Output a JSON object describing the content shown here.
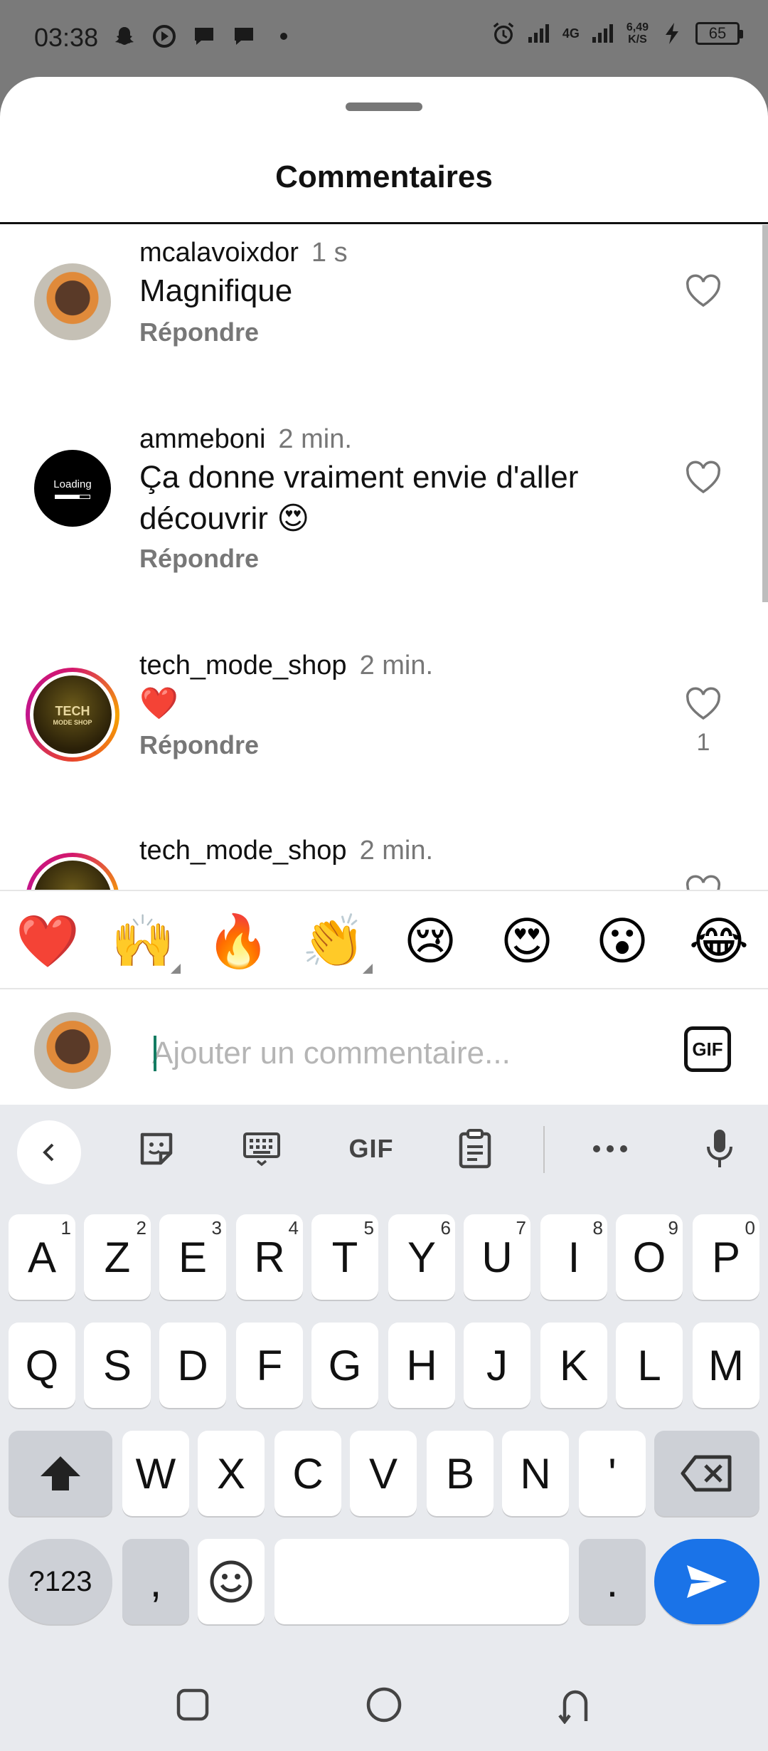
{
  "status_bar": {
    "time": "03:38",
    "network": "4G",
    "speed_value": "6,49",
    "speed_unit": "K/S",
    "battery": "65"
  },
  "sheet": {
    "title": "Commentaires"
  },
  "comments": [
    {
      "user": "mcalavoixdor",
      "time": "1 s",
      "text": "Magnifique",
      "reply": "Répondre",
      "likes": ""
    },
    {
      "user": "ammeboni",
      "time": "2 min.",
      "text": "Ça donne vraiment envie d'aller découvrir 😍",
      "reply": "Répondre",
      "likes": ""
    },
    {
      "user": "tech_mode_shop",
      "time": "2 min.",
      "text": "❤️",
      "reply": "Répondre",
      "likes": "1"
    },
    {
      "user": "tech_mode_shop",
      "time": "2 min.",
      "text": "",
      "reply": "",
      "likes": ""
    }
  ],
  "avatar_texts": {
    "loading": "Loading",
    "tech": "TECH",
    "tech_sub": "MODE SHOP"
  },
  "emoji_bar": [
    "❤️",
    "🙌",
    "🔥",
    "👏",
    "😢",
    "😍",
    "😮",
    "😂"
  ],
  "input": {
    "placeholder": "Ajouter un commentaire...",
    "gif_label": "GIF"
  },
  "keyboard": {
    "toolbar_gif": "GIF",
    "row1": [
      {
        "k": "A",
        "h": "1"
      },
      {
        "k": "Z",
        "h": "2"
      },
      {
        "k": "E",
        "h": "3"
      },
      {
        "k": "R",
        "h": "4"
      },
      {
        "k": "T",
        "h": "5"
      },
      {
        "k": "Y",
        "h": "6"
      },
      {
        "k": "U",
        "h": "7"
      },
      {
        "k": "I",
        "h": "8"
      },
      {
        "k": "O",
        "h": "9"
      },
      {
        "k": "P",
        "h": "0"
      }
    ],
    "row2": [
      "Q",
      "S",
      "D",
      "F",
      "G",
      "H",
      "J",
      "K",
      "L",
      "M"
    ],
    "row3": [
      "W",
      "X",
      "C",
      "V",
      "B",
      "N",
      "'"
    ],
    "sym_label": "?123",
    "comma": ",",
    "period": "."
  },
  "colors": {
    "accent_send": "#1a73e8",
    "caret": "#137c62",
    "story_ring": "#d3176d"
  }
}
